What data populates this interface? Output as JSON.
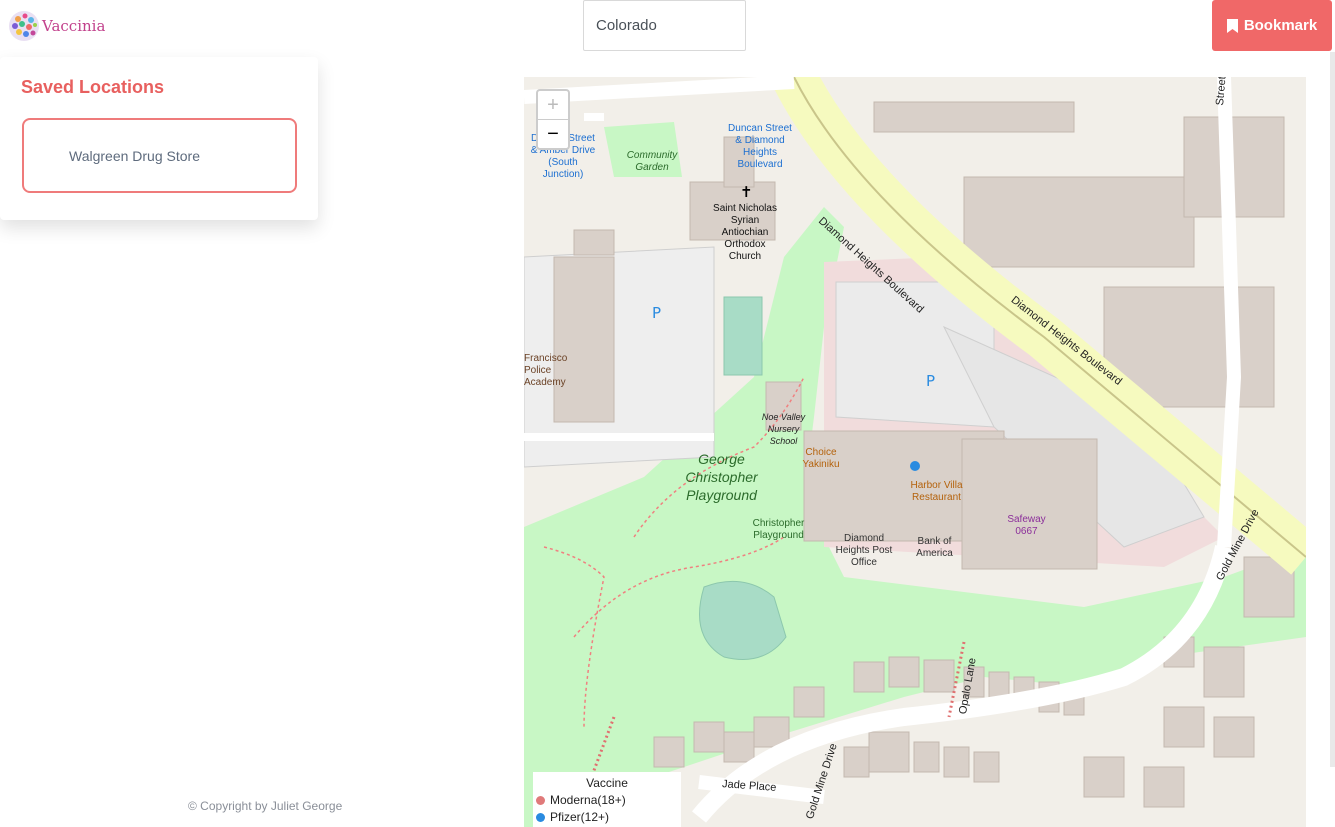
{
  "app": {
    "name": "Vaccinia"
  },
  "search": {
    "value": "Colorado"
  },
  "header": {
    "bookmark_label": "Bookmark"
  },
  "sidebar": {
    "title": "Saved Locations",
    "items": [
      {
        "label": "Walgreen Drug Store"
      }
    ]
  },
  "footer": {
    "copyright": "© Copyright by Juliet George"
  },
  "map": {
    "zoom_in": "+",
    "zoom_out": "−",
    "legend": {
      "title": "Vaccine",
      "items": [
        {
          "label": "Moderna(18+)",
          "color": "#e07a7a"
        },
        {
          "label": "Pfizer(12+)",
          "color": "#2a8be0"
        }
      ]
    },
    "labels": {
      "duncan_stop": "Duncan Street & Diamond Heights Boulevard",
      "duncan_amber": "Duncan Street & Amber Drive (South Junction)",
      "community_garden": "Community Garden",
      "church": "Saint Nicholas Syrian Antiochian Orthodox Church",
      "police": "Francisco Police Academy",
      "nursery": "Noe Valley Nursery School",
      "choice": "Choice Yakiniku",
      "harbor": "Harbor Villa Restaurant",
      "safeway": "Safeway 0667",
      "post_office": "Diamond Heights Post Office",
      "bank": "Bank of America",
      "playground_big": "George Christopher Playground",
      "playground_small": "Christopher Playground",
      "street_dhb": "Diamond Heights Boulevard",
      "street_gold": "Gold Mine Drive",
      "street_opalo": "Opalo Lane",
      "street_jade": "Jade Place",
      "street_top": "Street"
    }
  }
}
